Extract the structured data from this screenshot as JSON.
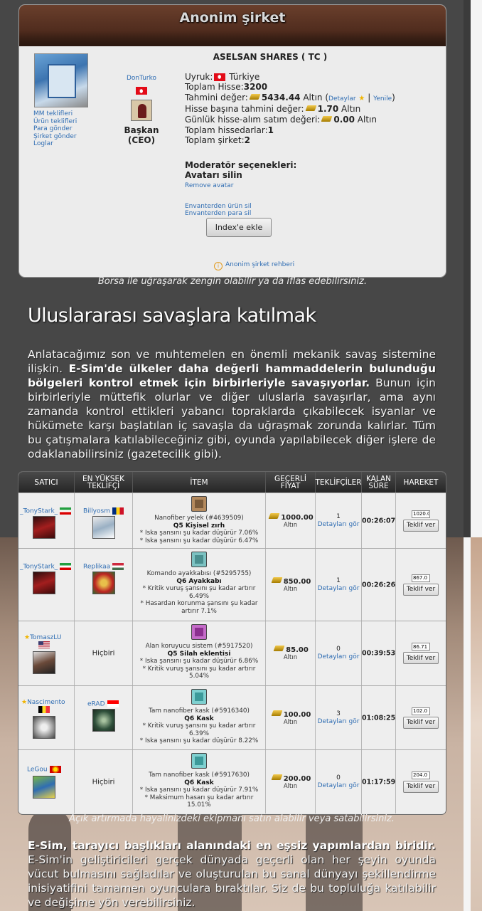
{
  "colors": {
    "link": "#2f6db3",
    "page_bg": "#474747",
    "panel_bg": "#ececec"
  },
  "company": {
    "header_title": "Anonim şirket",
    "side_links": [
      "MM teklifleri",
      "Ürün teklifleri",
      "Para gönder",
      "Şirket gönder",
      "Loglar"
    ],
    "ceo_name": "DonTurko",
    "ceo_role": "Başkan (CEO)",
    "name": "ASELSAN SHARES ( TC )",
    "citizenship_label": "Uyruk:",
    "citizenship_value": "Türkiye",
    "total_shares_label": "Toplam Hisse:",
    "total_shares_value": "3200",
    "est_value_label": "Tahmini değer:",
    "est_value_amount": "5434.44",
    "est_value_currency": "Altın (",
    "details_link": "Detaylar",
    "refresh_link": "Yenile",
    "share_value_label": "Hisse başına tahmini değer:",
    "share_value_amount": "1.70",
    "share_value_currency": "Altın",
    "daily_label": "Günlük hisse-alım satım değeri:",
    "daily_amount": "0.00",
    "daily_currency": "Altın",
    "shareholders_label": "Toplam hissedarlar:",
    "shareholders_value": "1",
    "companies_label": "Toplam şirket:",
    "companies_value": "2",
    "mod_title": "Moderatör seçenekleri:",
    "avatar_delete": "Avatarı silin",
    "remove_avatar": "Remove avatar",
    "inv_remove_product": "Envanterden ürün sil",
    "inv_remove_money": "Envanterden para sil",
    "index_button": "Index'e ekle",
    "guide_link": "Anonim şirket rehberi"
  },
  "caption1": "Borsa ile uğraşarak zengin olabilir ya da iflas edebilirsiniz.",
  "section_title": "Uluslararası savaşlara katılmak",
  "para1": {
    "part1": "Anlatacağımız son ve muhtemelen en önemli mekanik savaş sistemine ilişkin. ",
    "bold": "E-Sim'de ülkeler daha değerli hammaddelerin bulunduğu bölgeleri kontrol etmek için birbirleriyle savaşıyorlar.",
    "part2": " Bunun için birbirleriyle müttefik olurlar ve diğer uluslarla savaşırlar, ama aynı zamanda kontrol ettikleri yabancı topraklarda çıkabilecek isyanlar ve hükümete karşı başlatılan iç savaşla da uğraşmak zorunda kalırlar. Tüm bu çatışmalara katılabileceğiniz gibi, oyunda yapılabilecek diğer işlere de odaklanabilirsiniz (gazetecilik gibi)."
  },
  "auction": {
    "headers": [
      "SATICI",
      "EN YÜKSEK TEKLİFÇİ",
      "İTEM",
      "GEÇERLİ FİYAT",
      "TEKLİFÇİLER",
      "KALAN SÜRE",
      "HAREKET"
    ],
    "rows": [
      {
        "seller": "_TonyStark_",
        "bidder": "Billyosm",
        "item_name": "Nanofiber yelek (#4639509)",
        "item_q": "Q5 Kişisel zırh",
        "item_effects": [
          "* Iska şansını şu kadar düşürür 7.06%",
          "* Iska şansını şu kadar düşürür 6.47%"
        ],
        "price": "1000.00",
        "currency": "Altın",
        "bidders": "1",
        "details": "Detayları gör",
        "time": "00:26:07",
        "input_value": "1020.0",
        "bid_button": "Teklif ver"
      },
      {
        "seller": "_TonyStark_",
        "bidder": "Replikaa",
        "item_name": "Komando ayakkabısı (#5295755)",
        "item_q": "Q6 Ayakkabı",
        "item_effects": [
          "* Kritik vuruş şansını şu kadar artırır 6.49%",
          "* Hasardan korunma şansını şu kadar artırır 7.1%"
        ],
        "price": "850.00",
        "currency": "Altın",
        "bidders": "1",
        "details": "Detayları gör",
        "time": "00:26:26",
        "input_value": "867.0",
        "bid_button": "Teklif ver"
      },
      {
        "seller": "TomaszLU",
        "bidder": "Hiçbiri",
        "item_name": "Alan koruyucu sistem (#5917520)",
        "item_q": "Q5 Silah eklentisi",
        "item_effects": [
          "* Iska şansını şu kadar düşürür 6.86%",
          "* Kritik vuruş şansını şu kadar artırır 5.04%"
        ],
        "price": "85.00",
        "currency": "Altın",
        "bidders": "0",
        "details": "Detayları gör",
        "time": "00:39:53",
        "input_value": "86.71",
        "bid_button": "Teklif ver"
      },
      {
        "seller": "Nascimento",
        "bidder": "eRAD",
        "item_name": "Tam nanofiber kask (#5916340)",
        "item_q": "Q6 Kask",
        "item_effects": [
          "* Kritik vuruş şansını şu kadar artırır 6.39%",
          "* Iska şansını şu kadar düşürür 8.22%"
        ],
        "price": "100.00",
        "currency": "Altın",
        "bidders": "3",
        "details": "Detayları gör",
        "time": "01:08:25",
        "input_value": "102.0",
        "bid_button": "Teklif ver"
      },
      {
        "seller": "LeGou",
        "bidder": "Hiçbiri",
        "item_name": "Tam nanofiber kask (#5917630)",
        "item_q": "Q6 Kask",
        "item_effects": [
          "* Iska şansını şu kadar düşürür 7.91%",
          "* Maksimum hasarı şu kadar artırır 15.01%"
        ],
        "price": "200.00",
        "currency": "Altın",
        "bidders": "0",
        "details": "Detayları gör",
        "time": "01:17:59",
        "input_value": "204.0",
        "bid_button": "Teklif ver"
      }
    ]
  },
  "caption2": "Açık artırmada hayalinizdeki ekipmanı satın alabilir veya satabilirsiniz.",
  "para2": {
    "bold": "E-Sim, tarayıcı başlıkları alanındaki en eşsiz yapımlardan biridir.",
    "part": " E-Sim'in geliştiricileri gerçek dünyada geçerli olan her şeyin oyunda vücut bulmasını sağladılar ve oluşturulan bu sanal dünyayı şekillendirme inisiyatifini tamamen oyunculara bıraktılar. Siz de bu topluluğa katılabilir ve değişime yön verebilirsiniz."
  }
}
